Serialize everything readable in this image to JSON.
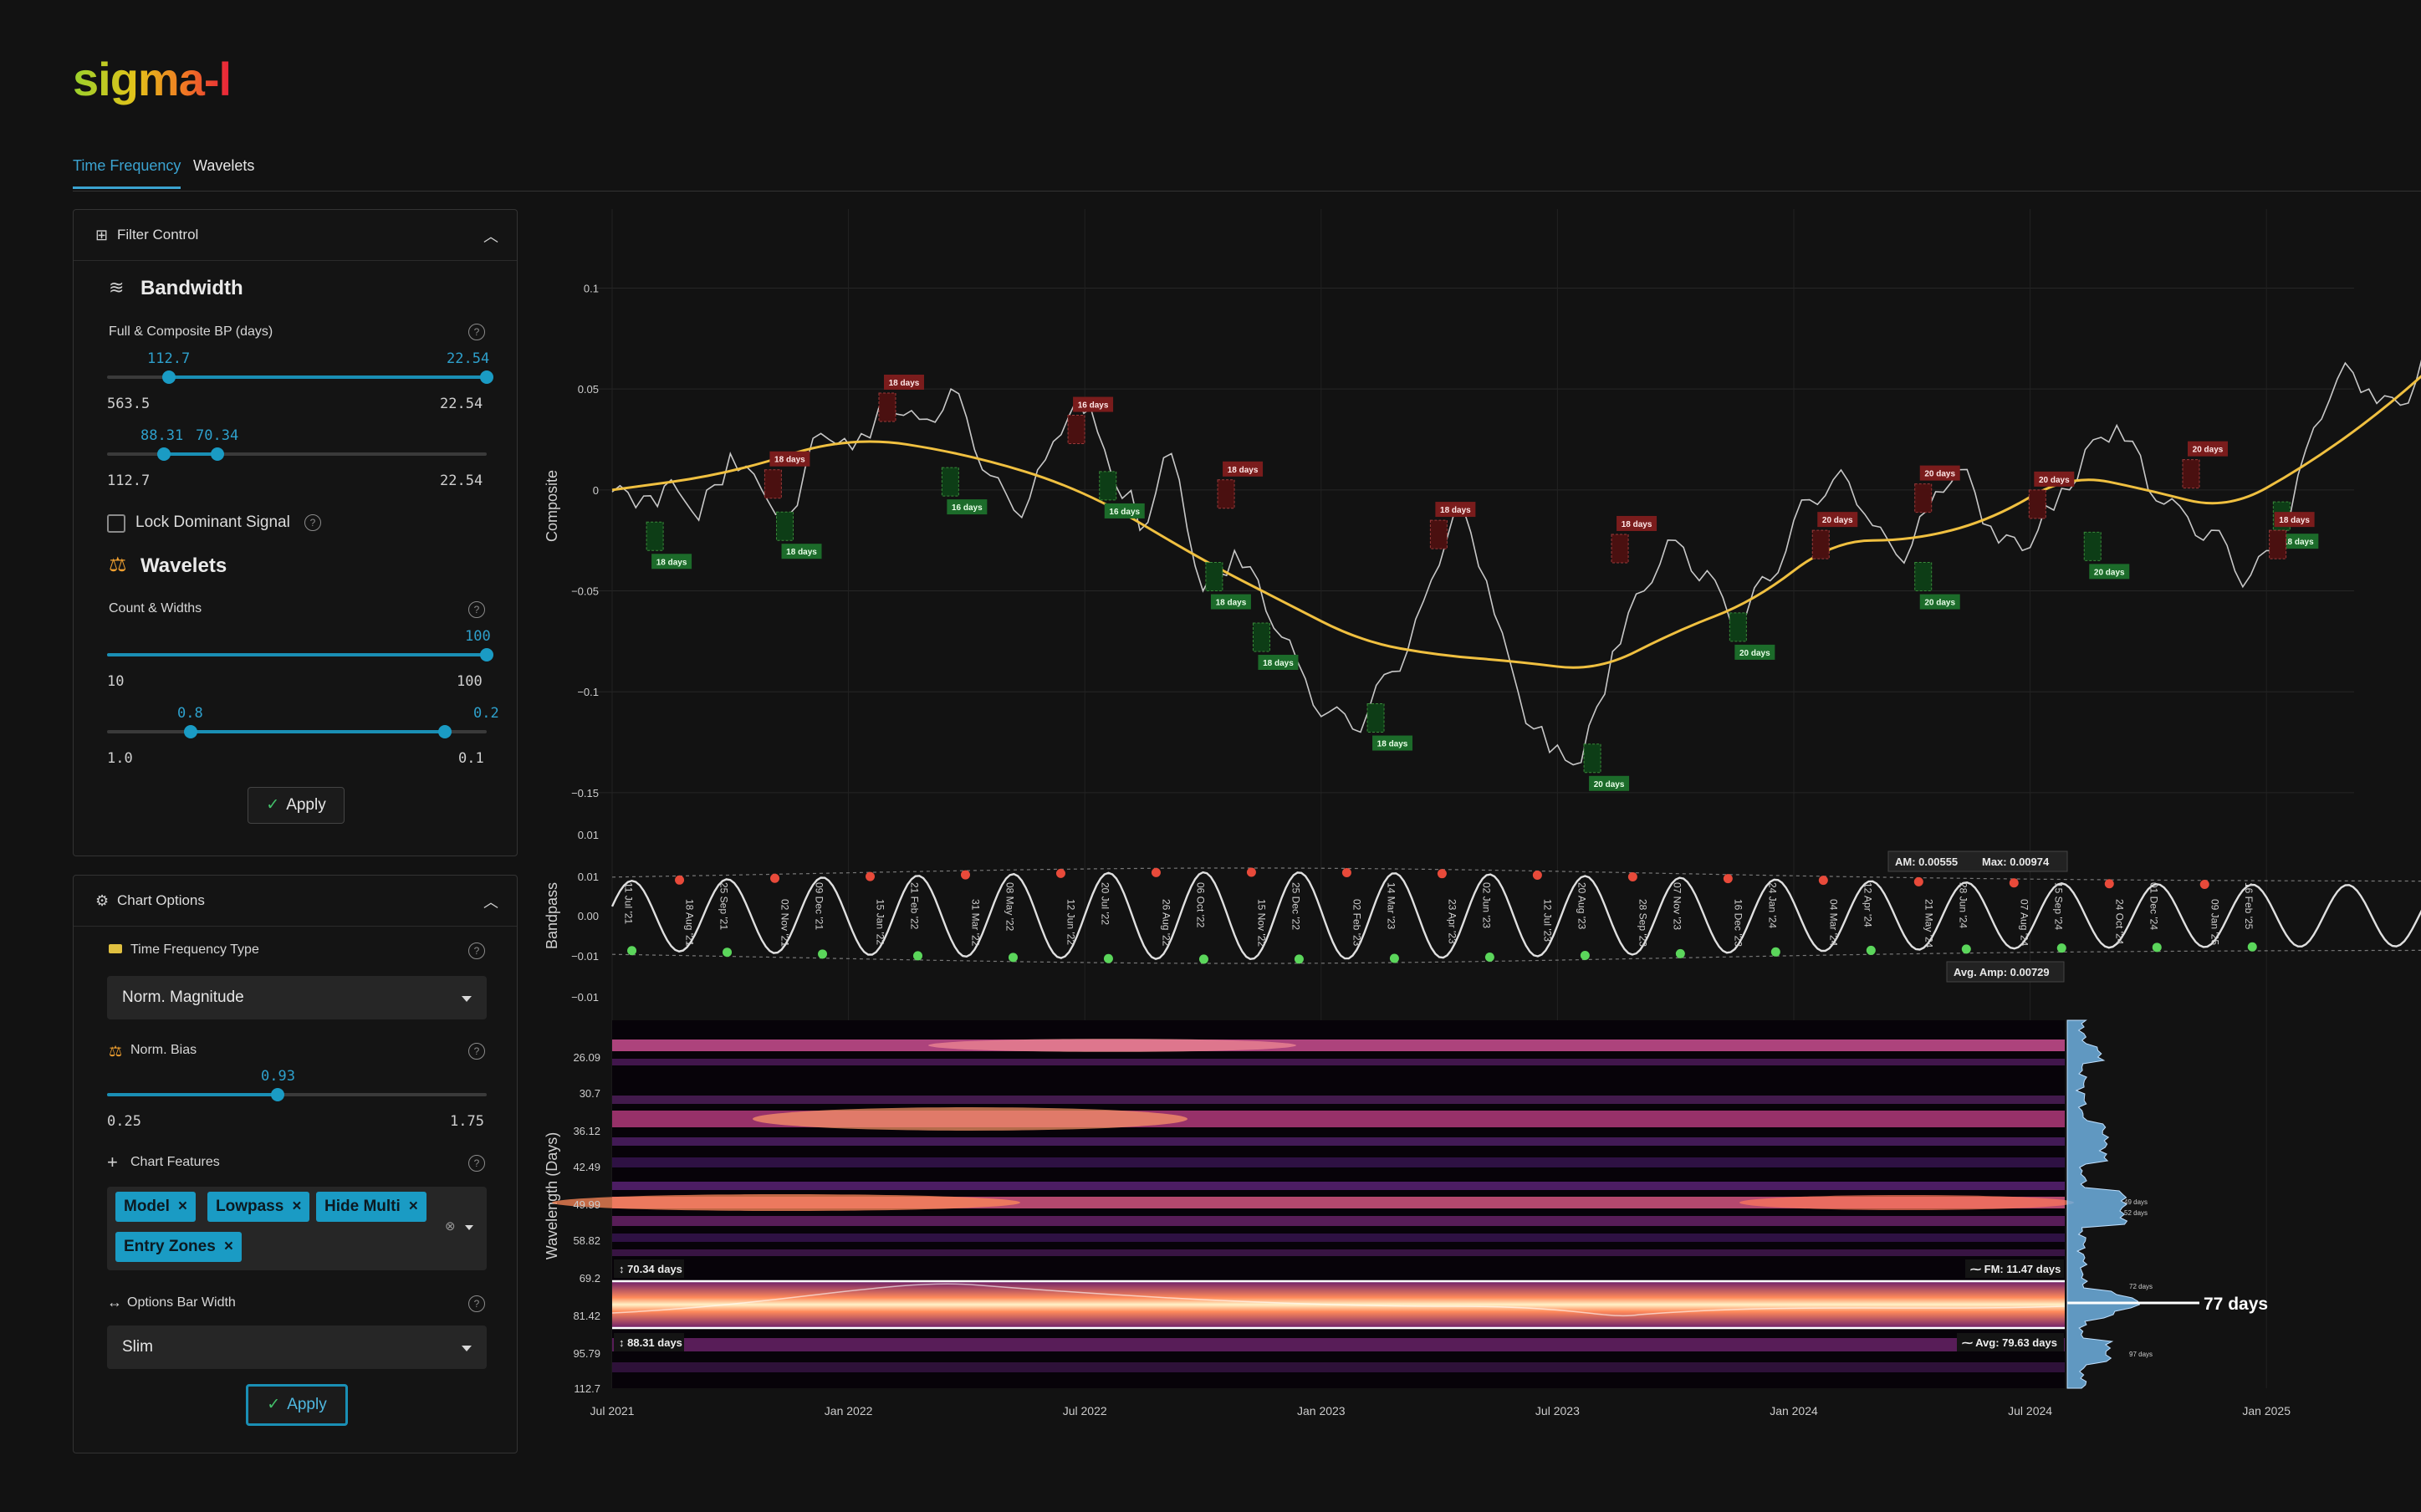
{
  "app": {
    "logo": "sigma-l"
  },
  "tabs": [
    {
      "label": "Time Frequency",
      "active": true
    },
    {
      "label": "Wavelets",
      "active": false
    }
  ],
  "filter_control": {
    "title": "Filter Control",
    "bandwidth": {
      "title": "Bandwidth",
      "label": "Full & Composite BP (days)",
      "slider1": {
        "low_value": "112.7",
        "high_value": "22.54",
        "min": "563.5",
        "max": "22.54"
      },
      "slider2": {
        "low_value": "88.31",
        "high_value": "70.34",
        "min": "112.7",
        "max": "22.54"
      }
    },
    "lock_dominant": {
      "label": "Lock Dominant Signal",
      "checked": false
    },
    "wavelets": {
      "title": "Wavelets",
      "label": "Count & Widths",
      "count": {
        "value": "100",
        "min": "10",
        "max": "100"
      },
      "widths": {
        "low_value": "0.8",
        "high_value": "0.2",
        "min": "1.0",
        "max": "0.1"
      }
    },
    "apply_label": "Apply"
  },
  "chart_options": {
    "title": "Chart Options",
    "tf_type": {
      "label": "Time Frequency Type",
      "value": "Norm. Magnitude"
    },
    "norm_bias": {
      "label": "Norm. Bias",
      "value": "0.93",
      "min": "0.25",
      "max": "1.75"
    },
    "features": {
      "label": "Chart Features",
      "chips": [
        "Model",
        "Lowpass",
        "Hide Multi",
        "Entry Zones"
      ]
    },
    "bar_width": {
      "label": "Options Bar Width",
      "value": "Slim"
    },
    "apply_label": "Apply"
  },
  "colors": {
    "accent": "#1a9bc4",
    "lowpass": "#f0c040",
    "peak": "#e84a3a",
    "trough": "#5bd65b"
  },
  "chart_data": [
    {
      "type": "line",
      "ylabel": "Composite",
      "yticks": [
        "0.1",
        "0.05",
        "0",
        "−0.05",
        "−0.1",
        "−0.15"
      ],
      "ylim": [
        -0.155,
        0.135
      ],
      "price": [
        [
          0,
          -0.001
        ],
        [
          0.8,
          -0.003
        ],
        [
          1.5,
          0.005
        ],
        [
          2.2,
          -0.015
        ],
        [
          3,
          0.018
        ],
        [
          3.8,
          0.0
        ],
        [
          4.5,
          -0.012
        ],
        [
          5.3,
          0.028
        ],
        [
          6.1,
          0.02
        ],
        [
          7,
          0.044
        ],
        [
          7.8,
          0.035
        ],
        [
          8.6,
          0.05
        ],
        [
          9.4,
          0.01
        ],
        [
          10.2,
          -0.01
        ],
        [
          11,
          0.015
        ],
        [
          11.8,
          0.045
        ],
        [
          12.5,
          0.02
        ],
        [
          13.4,
          -0.02
        ],
        [
          14.2,
          0.018
        ],
        [
          15,
          -0.05
        ],
        [
          15.8,
          -0.03
        ],
        [
          16.6,
          -0.06
        ],
        [
          17.4,
          -0.085
        ],
        [
          18.2,
          -0.11
        ],
        [
          19,
          -0.12
        ],
        [
          19.8,
          -0.09
        ],
        [
          20.6,
          -0.055
        ],
        [
          21.4,
          -0.01
        ],
        [
          22.2,
          -0.045
        ],
        [
          23,
          -0.1
        ],
        [
          23.8,
          -0.13
        ],
        [
          24.6,
          -0.135
        ],
        [
          25.4,
          -0.08
        ],
        [
          26.2,
          -0.05
        ],
        [
          27,
          -0.025
        ],
        [
          27.8,
          -0.04
        ],
        [
          28.6,
          -0.07
        ],
        [
          29.4,
          -0.045
        ],
        [
          30.2,
          -0.005
        ],
        [
          31,
          0.005
        ],
        [
          31.8,
          -0.012
        ],
        [
          32.6,
          -0.032
        ],
        [
          33.4,
          -0.01
        ],
        [
          34.2,
          0.01
        ],
        [
          35,
          -0.018
        ],
        [
          35.8,
          -0.03
        ],
        [
          36.6,
          -0.01
        ],
        [
          37.4,
          0.02
        ],
        [
          38.2,
          0.032
        ],
        [
          39,
          0.0
        ],
        [
          39.8,
          -0.008
        ],
        [
          40.6,
          -0.02
        ],
        [
          41.4,
          -0.048
        ],
        [
          42.2,
          -0.03
        ],
        [
          43,
          0.02
        ],
        [
          43.8,
          0.055
        ],
        [
          44.6,
          0.05
        ],
        [
          45.4,
          0.042
        ],
        [
          46.2,
          0.07
        ],
        [
          47,
          0.088
        ],
        [
          47.8,
          0.1
        ],
        [
          48.6,
          0.082
        ],
        [
          49.4,
          0.113
        ],
        [
          50.2,
          0.1
        ],
        [
          51,
          0.105
        ],
        [
          51.8,
          0.12
        ],
        [
          52.6,
          0.108
        ]
      ],
      "lowpass": [
        [
          0,
          0.0
        ],
        [
          3,
          0.008
        ],
        [
          6,
          0.027
        ],
        [
          9,
          0.018
        ],
        [
          12,
          0.0
        ],
        [
          15,
          -0.035
        ],
        [
          17,
          -0.055
        ],
        [
          19,
          -0.075
        ],
        [
          21,
          -0.082
        ],
        [
          23,
          -0.085
        ],
        [
          25,
          -0.09
        ],
        [
          27,
          -0.07
        ],
        [
          29,
          -0.055
        ],
        [
          31,
          -0.025
        ],
        [
          33,
          -0.025
        ],
        [
          35,
          -0.015
        ],
        [
          37,
          0.008
        ],
        [
          39,
          0.0
        ],
        [
          41,
          -0.01
        ],
        [
          43,
          0.012
        ],
        [
          45,
          0.04
        ],
        [
          47,
          0.075
        ],
        [
          49,
          0.095
        ],
        [
          51,
          0.112
        ],
        [
          52.6,
          0.115
        ]
      ],
      "x_months_from_jul_2021": true,
      "trough_labels": [
        "18 days",
        "18 days",
        "16 days",
        "16 days",
        "18 days",
        "18 days",
        "18 days",
        "20 days",
        "20 days",
        "20 days",
        "20 days",
        "18 days",
        "18 days",
        "18 days",
        "18 days"
      ],
      "peak_labels": [
        "18 days",
        "18 days",
        "16 days",
        "18 days",
        "18 days",
        "18 days",
        "20 days",
        "20 days",
        "20 days",
        "20 days",
        "18 days",
        "18 days",
        "18 days",
        "18 days"
      ]
    },
    {
      "type": "line",
      "ylabel": "Bandpass",
      "yticks": [
        "0.01",
        "0.01",
        "0.00",
        "−0.01",
        "−0.01"
      ],
      "am_label": "AM: 0.00555",
      "max_label": "Max: 0.00974",
      "avg_amp_label": "Avg. Amp: 0.00729",
      "dates": [
        "11 Jul '21",
        "18 Aug '21",
        "25 Sep '21",
        "02 Nov '21",
        "09 Dec '21",
        "15 Jan '22",
        "21 Feb '22",
        "31 Mar '22",
        "08 May '22",
        "12 Jun '22",
        "20 Jul '22",
        "26 Aug '22",
        "06 Oct '22",
        "15 Nov '22",
        "25 Dec '22",
        "02 Feb '23",
        "14 Mar '23",
        "23 Apr '23",
        "02 Jun '23",
        "12 Jul '23",
        "20 Aug '23",
        "28 Sep '23",
        "07 Nov '23",
        "16 Dec '23",
        "24 Jan '24",
        "04 Mar '24",
        "12 Apr '24",
        "21 May '24",
        "28 Jun '24",
        "07 Aug '24",
        "15 Sep '24",
        "24 Oct '24",
        "01 Dec '24",
        "09 Jan '25",
        "16 Feb '25"
      ]
    },
    {
      "type": "heatmap",
      "ylabel": "Wavelength (Days)",
      "yticks": [
        "26.09",
        "30.7",
        "36.12",
        "42.49",
        "49.99",
        "58.82",
        "69.2",
        "81.42",
        "95.79",
        "112.7"
      ],
      "xticks": [
        "Jul 2021",
        "Jan 2022",
        "Jul 2022",
        "Jan 2023",
        "Jul 2023",
        "Jan 2024",
        "Jul 2024",
        "Jan 2025"
      ],
      "band_high_label": "70.34 days",
      "band_low_label": "88.31 days",
      "fm_label": "FM: 11.47 days",
      "avg_label": "Avg: 79.63 days",
      "dominant_label": "77 days",
      "spectrum_labels": [
        "49 days",
        "52 days",
        "72 days",
        "97 days"
      ]
    }
  ]
}
